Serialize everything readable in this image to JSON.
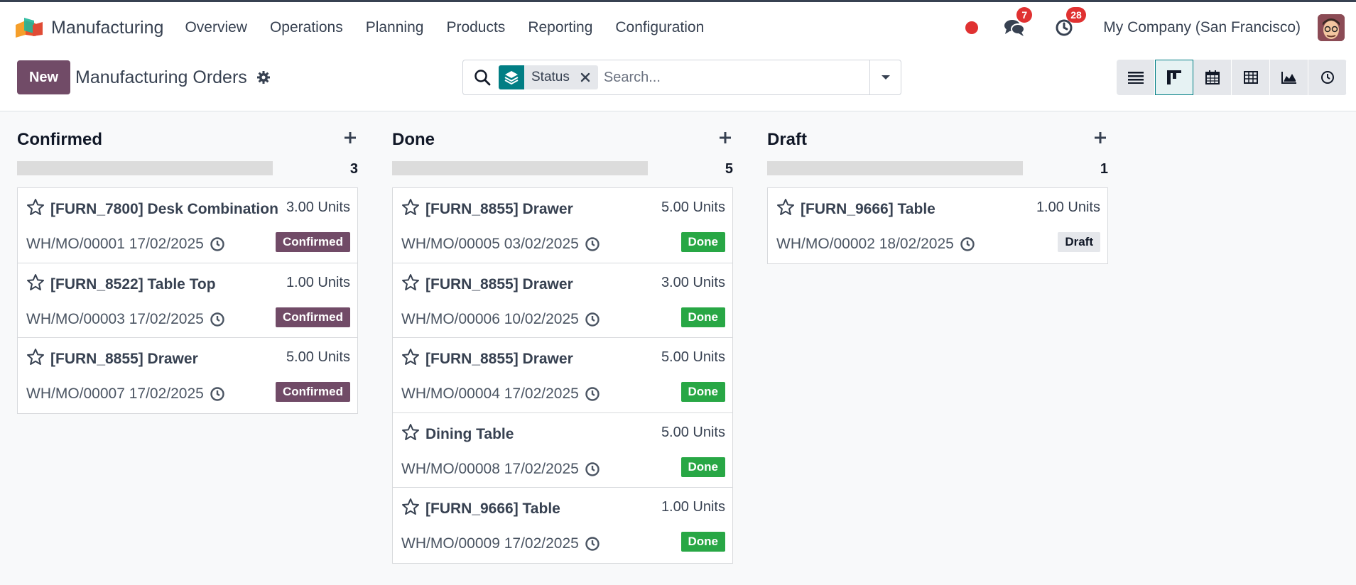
{
  "app": {
    "name": "Manufacturing",
    "menu": [
      "Overview",
      "Operations",
      "Planning",
      "Products",
      "Reporting",
      "Configuration"
    ]
  },
  "nav": {
    "messages_count": "7",
    "activities_count": "28",
    "company": "My Company (San Francisco)"
  },
  "control": {
    "new_label": "New",
    "title": "Manufacturing Orders",
    "facet_label": "Status",
    "search_placeholder": "Search..."
  },
  "colors": {
    "brand": "#714b67",
    "teal": "#017e84",
    "done": "#28a745",
    "draft_bg": "#e5e7eb"
  },
  "columns": [
    {
      "title": "Confirmed",
      "count": "3",
      "cards": [
        {
          "title": "[FURN_7800] Desk Combination",
          "qty": "3.00 Units",
          "ref": "WH/MO/00001 17/02/2025",
          "status": "Confirmed"
        },
        {
          "title": "[FURN_8522] Table Top",
          "qty": "1.00 Units",
          "ref": "WH/MO/00003 17/02/2025",
          "status": "Confirmed"
        },
        {
          "title": "[FURN_8855] Drawer",
          "qty": "5.00 Units",
          "ref": "WH/MO/00007 17/02/2025",
          "status": "Confirmed"
        }
      ]
    },
    {
      "title": "Done",
      "count": "5",
      "cards": [
        {
          "title": "[FURN_8855] Drawer",
          "qty": "5.00 Units",
          "ref": "WH/MO/00005 03/02/2025",
          "status": "Done"
        },
        {
          "title": "[FURN_8855] Drawer",
          "qty": "3.00 Units",
          "ref": "WH/MO/00006 10/02/2025",
          "status": "Done"
        },
        {
          "title": "[FURN_8855] Drawer",
          "qty": "5.00 Units",
          "ref": "WH/MO/00004 17/02/2025",
          "status": "Done"
        },
        {
          "title": "Dining Table",
          "qty": "5.00 Units",
          "ref": "WH/MO/00008 17/02/2025",
          "status": "Done"
        },
        {
          "title": "[FURN_9666] Table",
          "qty": "1.00 Units",
          "ref": "WH/MO/00009 17/02/2025",
          "status": "Done"
        }
      ]
    },
    {
      "title": "Draft",
      "count": "1",
      "cards": [
        {
          "title": "[FURN_9666] Table",
          "qty": "1.00 Units",
          "ref": "WH/MO/00002 18/02/2025",
          "status": "Draft"
        }
      ]
    }
  ]
}
